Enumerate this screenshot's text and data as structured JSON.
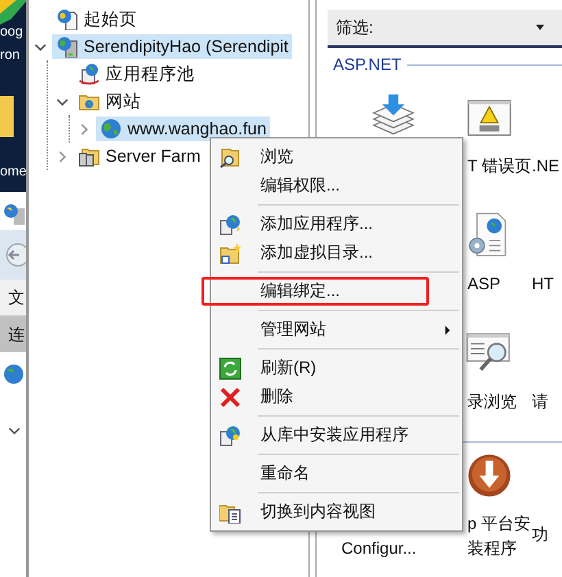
{
  "background_window": {
    "texts": [
      "oog",
      "ron",
      "ome"
    ],
    "toolbar_labels": [
      "文",
      "连"
    ]
  },
  "tree": [
    {
      "label": "起始页",
      "kind": "start",
      "selected": false
    },
    {
      "label": "SerendipityHao (Serendipit",
      "kind": "server",
      "selected": true,
      "expanded": true,
      "children": [
        {
          "label": "应用程序池",
          "kind": "pool",
          "selected": false
        },
        {
          "label": "网站",
          "kind": "sites",
          "selected": false,
          "expanded": true,
          "children": [
            {
              "label": "www.wanghao.fun",
              "kind": "site",
              "selected": true,
              "expanded": false
            }
          ]
        },
        {
          "label": "Server Farm",
          "kind": "farm",
          "selected": false,
          "expanded": false
        }
      ]
    }
  ],
  "filter": {
    "label": "筛选:"
  },
  "features": {
    "groups": [
      {
        "title": "ASP.NET",
        "rows": [
          [
            {
              "kind": "compile"
            },
            {
              "kind": "error-page",
              "lines": [
                "T 错误页"
              ]
            },
            {
              "kind": "none",
              "lines": [
                ".NE"
              ]
            }
          ],
          [
            {
              "kind": "none"
            },
            {
              "kind": "asp",
              "lines": [
                "ASP"
              ]
            },
            {
              "kind": "none",
              "lines": [
                "HT"
              ]
            }
          ],
          [
            {
              "kind": "none"
            },
            {
              "kind": "dir-browse",
              "lines": [
                "录浏览"
              ]
            },
            {
              "kind": "none",
              "lines": [
                "请"
              ]
            }
          ]
        ]
      },
      {
        "rows": [
          [
            {
              "kind": "none",
              "lines": [
                "Configur..."
              ]
            },
            {
              "kind": "web-platform",
              "lines": [
                "p 平台安",
                "装程序"
              ]
            },
            {
              "kind": "none",
              "lines": [
                "功"
              ]
            }
          ]
        ]
      }
    ]
  },
  "context_menu": {
    "groups": [
      [
        {
          "label": "浏览",
          "kind": "browse"
        },
        {
          "label": "编辑权限...",
          "kind": "plain"
        }
      ],
      [
        {
          "label": "添加应用程序...",
          "kind": "add-app"
        },
        {
          "label": "添加虚拟目录...",
          "kind": "add-vdir"
        }
      ],
      [
        {
          "label": "编辑绑定...",
          "kind": "plain",
          "annotated": true
        }
      ],
      [
        {
          "label": "管理网站",
          "kind": "plain",
          "submenu": true
        }
      ],
      [
        {
          "label": "刷新(R)",
          "kind": "refresh"
        },
        {
          "label": "删除",
          "kind": "delete"
        }
      ],
      [
        {
          "label": "从库中安装应用程序",
          "kind": "install"
        }
      ],
      [
        {
          "label": "重命名",
          "kind": "plain"
        }
      ],
      [
        {
          "label": "切换到内容视图",
          "kind": "content-view"
        }
      ]
    ]
  }
}
